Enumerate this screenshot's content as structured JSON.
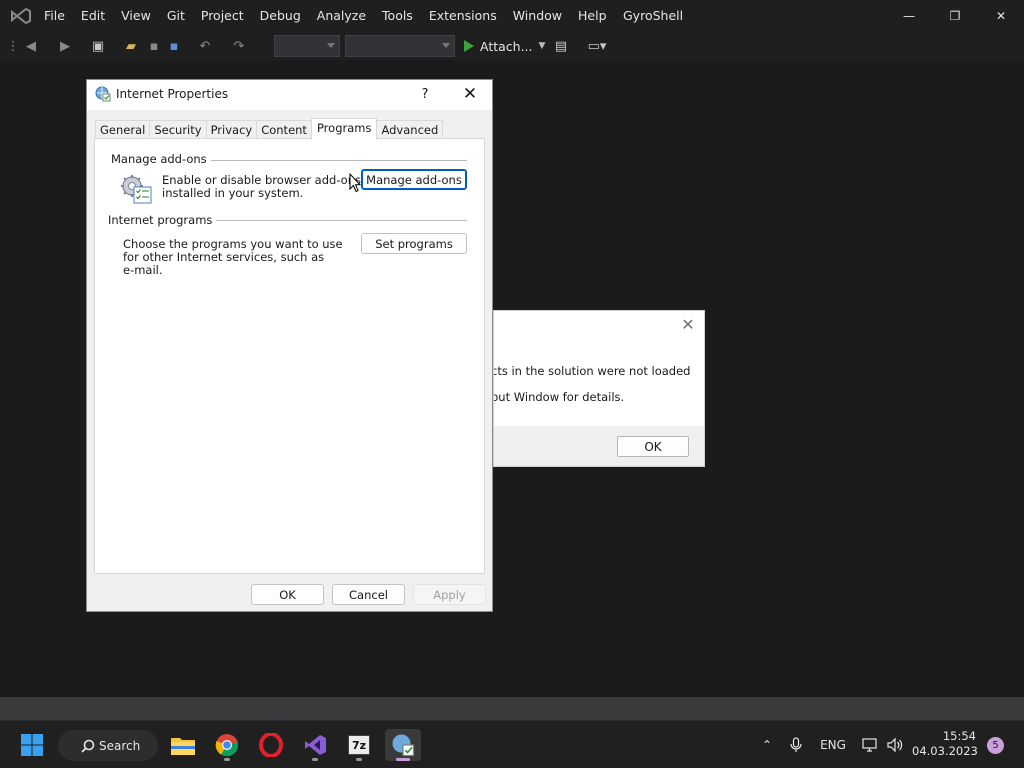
{
  "vs": {
    "menu": [
      "File",
      "Edit",
      "View",
      "Git",
      "Project",
      "Debug",
      "Analyze",
      "Tools",
      "Extensions",
      "Window",
      "Help"
    ],
    "solution_name": "GyroShell",
    "window_controls": {
      "minimize": "—",
      "restore": "❐",
      "close": "✕"
    },
    "toolbar": {
      "attach_label": "Attach..."
    }
  },
  "message_box": {
    "line1": "cts in the solution were not loaded",
    "line2": "put Window for details.",
    "ok_label": "OK",
    "close_glyph": "✕"
  },
  "internet_properties": {
    "title": "Internet Properties",
    "help_glyph": "?",
    "close_glyph": "✕",
    "tabs": [
      "General",
      "Security",
      "Privacy",
      "Content",
      "Programs",
      "Advanced"
    ],
    "active_tab": "Programs",
    "manage_addons": {
      "group_label": "Manage add-ons",
      "description_line1": "Enable or disable browser add-ons",
      "description_line2": "installed in your system.",
      "button_label": "Manage add-ons"
    },
    "internet_programs": {
      "group_label": "Internet programs",
      "description_line1": "Choose the programs you want to use",
      "description_line2": "for other Internet services, such as",
      "description_line3": "e-mail.",
      "button_label": "Set programs"
    },
    "footer": {
      "ok_label": "OK",
      "cancel_label": "Cancel",
      "apply_label": "Apply"
    }
  },
  "taskbar": {
    "search_label": "Search",
    "language": "ENG",
    "time": "15:54",
    "date": "04.03.2023",
    "notification_count": "5",
    "icons": [
      "windows-start-icon",
      "file-explorer-icon",
      "chrome-icon",
      "opera-icon",
      "visual-studio-icon",
      "7zip-icon",
      "internet-properties-icon"
    ]
  }
}
